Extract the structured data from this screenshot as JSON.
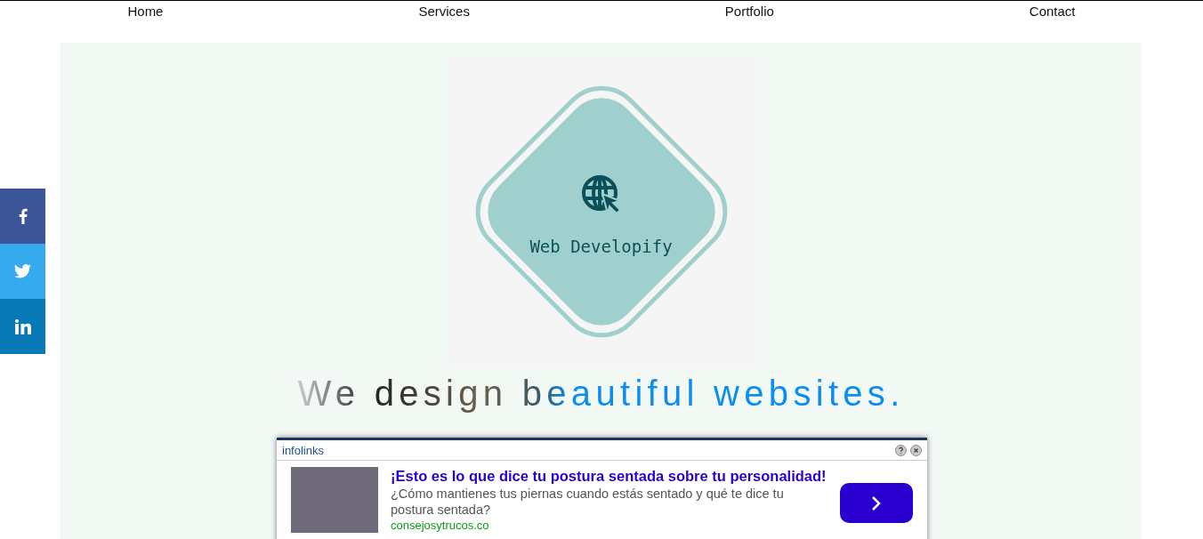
{
  "nav": [
    {
      "label": "Home"
    },
    {
      "label": "Services"
    },
    {
      "label": "Portfolio"
    },
    {
      "label": "Contact"
    }
  ],
  "social": [
    {
      "kind": "facebook",
      "color": "#3b5598"
    },
    {
      "kind": "twitter",
      "color": "#35aaee"
    },
    {
      "kind": "linkedin",
      "color": "#0779b6"
    }
  ],
  "logo": {
    "name": "Web Developify"
  },
  "headline": "We design beautiful websites.",
  "ad": {
    "brand": "infolinks",
    "title": "¡Esto es lo que dice tu postura sentada sobre tu personalidad!",
    "text": "¿Cómo mantienes tus piernas cuando estás sentado y qué te dice tu postura sentada?",
    "source": "consejosytrucos.co"
  }
}
